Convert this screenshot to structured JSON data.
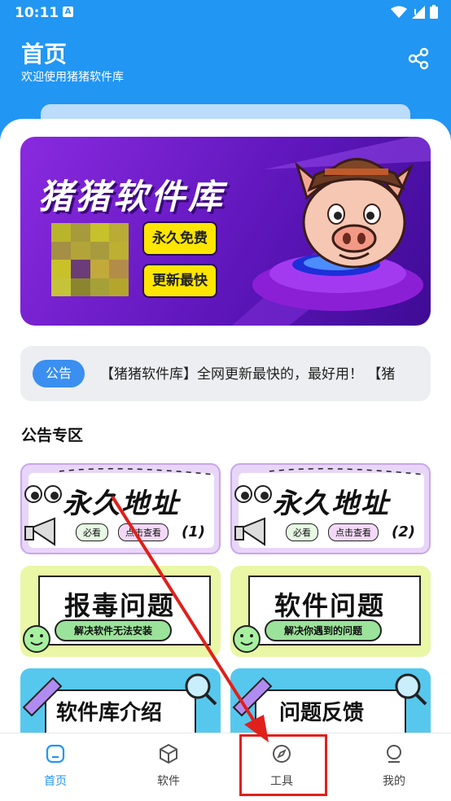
{
  "status_bar": {
    "time": "10:11",
    "notif_badge": "A"
  },
  "header": {
    "title": "首页",
    "subtitle": "欢迎使用猪猪软件库"
  },
  "banner": {
    "title": "猪猪软件库",
    "badge1": "永久免费",
    "badge2": "更新最快"
  },
  "notice": {
    "tag": "公告",
    "text": "【猪猪软件库】全网更新最快的，最好用！  【猪"
  },
  "section": {
    "title": "公告专区"
  },
  "cards": [
    {
      "title": "永久地址",
      "tag1": "必看",
      "tag2": "点击查看",
      "num": "(1)"
    },
    {
      "title": "永久地址",
      "tag1": "必看",
      "tag2": "点击查看",
      "num": "(2)"
    },
    {
      "title": "报毒问题",
      "sub": "解决软件无法安装"
    },
    {
      "title": "软件问题",
      "sub": "解决你遇到的问题"
    },
    {
      "title": "软件库介绍"
    },
    {
      "title": "问题反馈"
    }
  ],
  "nav": [
    {
      "label": "首页",
      "active": true,
      "icon": "home-icon"
    },
    {
      "label": "软件",
      "active": false,
      "icon": "cube-icon"
    },
    {
      "label": "工具",
      "active": false,
      "icon": "compass-icon"
    },
    {
      "label": "我的",
      "active": false,
      "icon": "user-icon"
    }
  ],
  "colors": {
    "primary": "#2196f3",
    "annotation": "#e0201b",
    "banner": "#6a1fc8",
    "badge": "#ffe600"
  }
}
